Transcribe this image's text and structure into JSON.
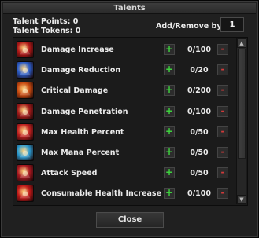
{
  "window": {
    "title": "Talents"
  },
  "summary": {
    "talent_points": "Talent Points: 0",
    "talent_tokens": "Talent Tokens: 0",
    "add_remove_label": "Add/Remove by:",
    "add_remove_value": "1"
  },
  "talents": [
    {
      "name": "Damage Increase",
      "value": "0/100",
      "plus": "+",
      "minus": "-",
      "icon": "damage-increase-icon",
      "color": "#b01818"
    },
    {
      "name": "Damage Reduction",
      "value": "0/20",
      "plus": "+",
      "minus": "-",
      "icon": "damage-reduction-icon",
      "color": "#2a5cc8"
    },
    {
      "name": "Critical Damage",
      "value": "0/200",
      "plus": "+",
      "minus": "-",
      "icon": "critical-damage-icon",
      "color": "#c84a10"
    },
    {
      "name": "Damage Penetration",
      "value": "0/100",
      "plus": "+",
      "minus": "-",
      "icon": "damage-penetration-icon",
      "color": "#a01a1a"
    },
    {
      "name": "Max Health Percent",
      "value": "0/50",
      "plus": "+",
      "minus": "-",
      "icon": "max-health-icon",
      "color": "#c02020"
    },
    {
      "name": "Max Mana Percent",
      "value": "0/50",
      "plus": "+",
      "minus": "-",
      "icon": "max-mana-icon",
      "color": "#2a9ad0"
    },
    {
      "name": "Attack Speed",
      "value": "0/50",
      "plus": "+",
      "minus": "-",
      "icon": "attack-speed-icon",
      "color": "#a81820"
    },
    {
      "name": "Consumable Health Increase",
      "value": "0/100",
      "plus": "+",
      "minus": "-",
      "icon": "consumable-health-icon",
      "color": "#c01818"
    }
  ],
  "close_label": "Close"
}
